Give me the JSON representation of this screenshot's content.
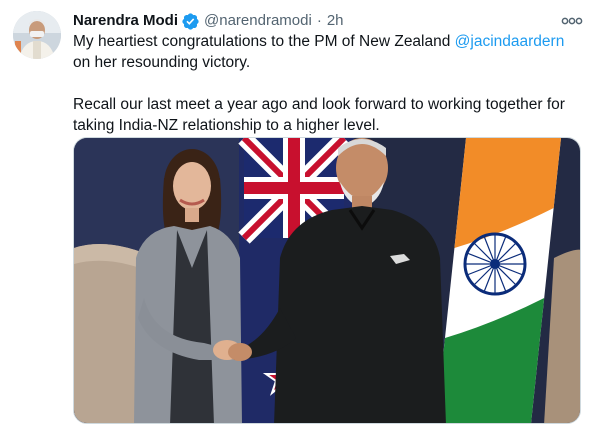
{
  "tweet": {
    "author_name": "Narendra Modi",
    "author_handle": "@narendramodi",
    "separator": "·",
    "timestamp": "2h",
    "text_line1_before_mention": "My heartiest congratulations to the PM of New Zealand ",
    "mention": "@jacindaardern",
    "text_line1_after_mention": " on her resounding victory.",
    "text_paragraph2": "Recall our last meet a year ago and look forward to working together for taking India-NZ relationship to a higher level."
  },
  "icons": {
    "verified": "verified-badge-icon",
    "more": "more-options-icon"
  },
  "colors": {
    "mention": "#1d9bf0",
    "verified": "#1d9bf0",
    "secondary_text": "#536471",
    "primary_text": "#0f1419"
  }
}
